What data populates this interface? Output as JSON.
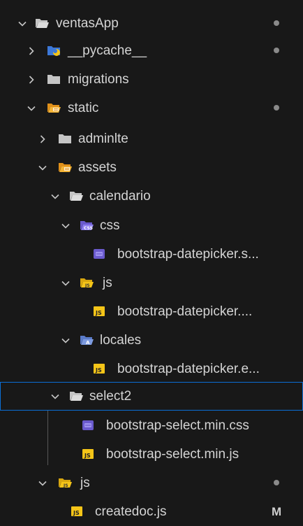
{
  "explorer": {
    "ventasapp": {
      "label": "ventasApp"
    },
    "pycache": {
      "label": "__pycache__"
    },
    "migrations": {
      "label": "migrations"
    },
    "static": {
      "label": "static"
    },
    "adminlte": {
      "label": "adminlte"
    },
    "assets": {
      "label": "assets"
    },
    "calendario": {
      "label": "calendario"
    },
    "css": {
      "label": "css"
    },
    "datepicker_css": {
      "label": "bootstrap-datepicker.s..."
    },
    "js_calendario": {
      "label": "js"
    },
    "datepicker_js": {
      "label": "bootstrap-datepicker...."
    },
    "locales": {
      "label": "locales"
    },
    "datepicker_locale": {
      "label": "bootstrap-datepicker.e..."
    },
    "select2": {
      "label": "select2"
    },
    "select_css": {
      "label": "bootstrap-select.min.css"
    },
    "select_js": {
      "label": "bootstrap-select.min.js"
    },
    "js_static": {
      "label": "js"
    },
    "createdoc": {
      "label": "createdoc.js",
      "badge": "M"
    }
  },
  "icons": {
    "folder": "folder-icon",
    "folder_open": "folder-open-icon",
    "python_folder": "python-folder-icon",
    "static_folder": "static-folder-icon",
    "css_folder": "css-folder-icon",
    "js_folder": "js-folder-icon",
    "locales_folder": "locales-folder-icon",
    "css_file": "css-file-icon",
    "js_file": "js-file-icon"
  },
  "colors": {
    "background": "#181818",
    "text": "#d4d4d4",
    "selection_border": "#0b6fd6",
    "modified_dot": "#8a8a8a",
    "folder": "#c5c5c5",
    "python_blue": "#3c78d8",
    "python_yellow": "#f5c518",
    "static_folder": "#f1a01a",
    "css_purple": "#6a5acd",
    "js_yellow": "#f5c518"
  }
}
